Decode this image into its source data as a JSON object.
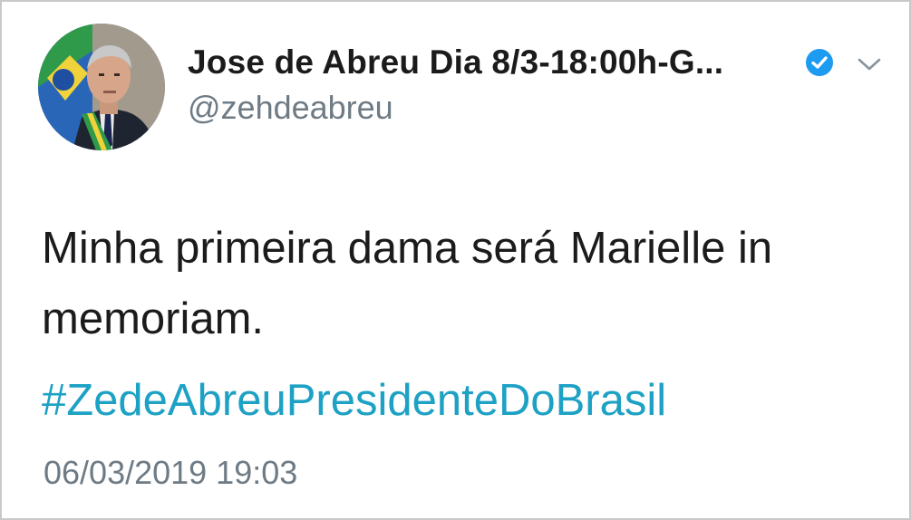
{
  "tweet": {
    "display_name": "Jose de Abreu Dia 8/3-18:00h-G...",
    "handle": "@zehdeabreu",
    "text_line1": "Minha primeira dama será Marielle in",
    "text_line2": "memoriam.",
    "hashtag": "#ZedeAbreuPresidenteDoBrasil",
    "timestamp": "06/03/2019 19:03",
    "avatar_icon": "profile-photo",
    "verified_icon": "verified-badge-icon",
    "menu_icon": "chevron-down-icon"
  },
  "colors": {
    "text": "#1b1b1b",
    "secondary": "#6e7b85",
    "hashtag": "#1da1c4",
    "verified": "#1d9bf0",
    "border": "#c9c9c9"
  }
}
